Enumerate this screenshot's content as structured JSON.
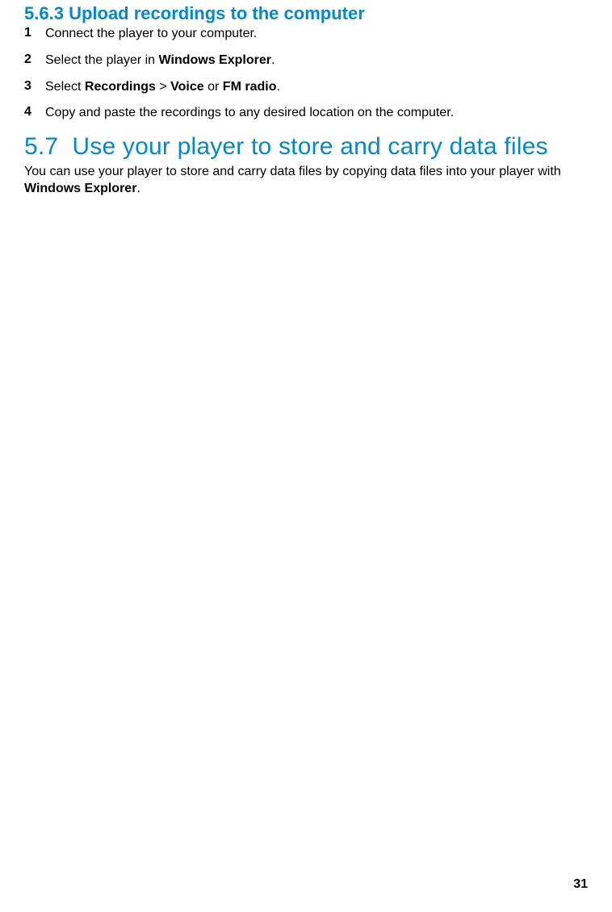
{
  "section563": {
    "number": "5.6.3",
    "title": "Upload recordings to the computer"
  },
  "steps": [
    {
      "number": "1",
      "text_pre": "Connect the player to your computer."
    },
    {
      "number": "2",
      "text_pre": "Select the player in ",
      "bold1": "Windows Explorer",
      "text_post": "."
    },
    {
      "number": "3",
      "text_pre": "Select ",
      "bold1": "Recordings",
      "text_mid1": " > ",
      "bold2": "Voice",
      "text_mid2": " or ",
      "bold3": "FM radio",
      "text_post": "."
    },
    {
      "number": "4",
      "text_pre": "Copy and paste the recordings to any desired location on the computer."
    }
  ],
  "section57": {
    "number": "5.7",
    "title": "Use your player to store and carry data files"
  },
  "body57": {
    "text_pre": "You can use your player to store and carry data files by copying data files into your player with ",
    "bold1": "Windows Explorer",
    "text_post": "."
  },
  "page_number": "31"
}
